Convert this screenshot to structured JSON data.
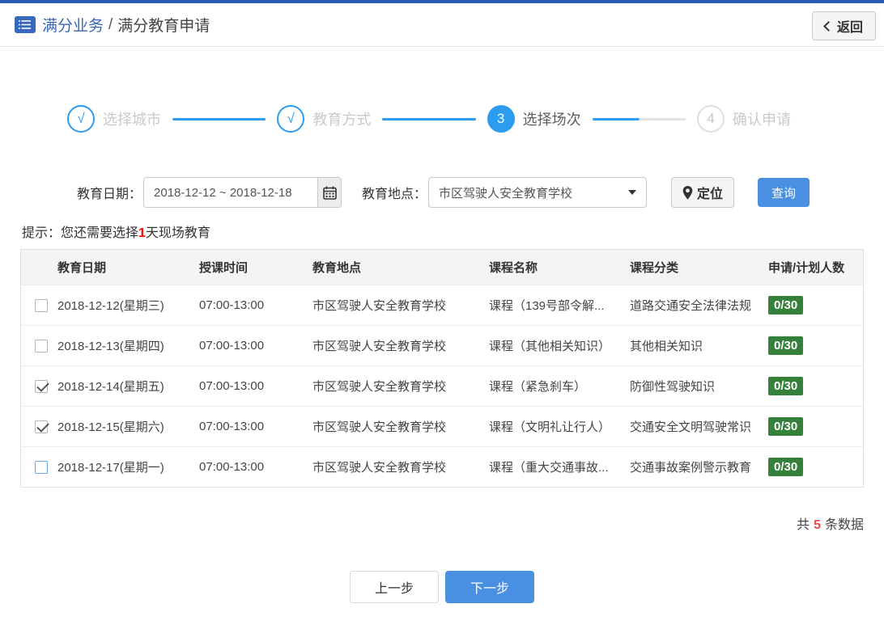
{
  "header": {
    "breadcrumb_primary": "满分业务",
    "breadcrumb_separator": "/",
    "breadcrumb_secondary": "满分教育申请",
    "back_button": "返回"
  },
  "steps": {
    "items": [
      {
        "num": "√",
        "label": "选择城市",
        "state": "done"
      },
      {
        "num": "√",
        "label": "教育方式",
        "state": "done"
      },
      {
        "num": "3",
        "label": "选择场次",
        "state": "active"
      },
      {
        "num": "4",
        "label": "确认申请",
        "state": "pending"
      }
    ]
  },
  "filters": {
    "date_label": "教育日期：",
    "date_value": "2018-12-12 ~ 2018-12-18",
    "location_label": "教育地点：",
    "location_value": "市区驾驶人安全教育学校",
    "locate_button": "定位",
    "search_button": "查询"
  },
  "hint": {
    "prefix": "提示：您还需要选择",
    "highlight": "1",
    "suffix": "天现场教育"
  },
  "table": {
    "columns": [
      "教育日期",
      "授课时间",
      "教育地点",
      "课程名称",
      "课程分类",
      "申请/计划人数"
    ],
    "rows": [
      {
        "checked": false,
        "date": "2018-12-12(星期三)",
        "time": "07:00-13:00",
        "place": "市区驾驶人安全教育学校",
        "course": "课程（139号部令解...",
        "category": "道路交通安全法律法规",
        "quota": "0/30"
      },
      {
        "checked": false,
        "date": "2018-12-13(星期四)",
        "time": "07:00-13:00",
        "place": "市区驾驶人安全教育学校",
        "course": "课程（其他相关知识）",
        "category": "其他相关知识",
        "quota": "0/30"
      },
      {
        "checked": true,
        "date": "2018-12-14(星期五)",
        "time": "07:00-13:00",
        "place": "市区驾驶人安全教育学校",
        "course": "课程（紧急刹车）",
        "category": "防御性驾驶知识",
        "quota": "0/30"
      },
      {
        "checked": true,
        "date": "2018-12-15(星期六)",
        "time": "07:00-13:00",
        "place": "市区驾驶人安全教育学校",
        "course": "课程（文明礼让行人）",
        "category": "交通安全文明驾驶常识",
        "quota": "0/30"
      },
      {
        "checked": false,
        "date": "2018-12-17(星期一)",
        "time": "07:00-13:00",
        "place": "市区驾驶人安全教育学校",
        "course": "课程（重大交通事故...",
        "category": "交通事故案例警示教育",
        "quota": "0/30"
      }
    ]
  },
  "summary": {
    "prefix": "共",
    "count": "5",
    "suffix": "条数据"
  },
  "footer": {
    "prev_button": "上一步",
    "next_button": "下一步"
  },
  "icons": {
    "header": "list-icon",
    "back": "chevron-left-icon",
    "date": "calendar-icon",
    "location_select": "caret-down-icon",
    "locate": "map-pin-icon"
  },
  "colors": {
    "top_bar": "#2b5cb5",
    "accent_blue": "#2d9cf0",
    "button_blue": "#4a90e2",
    "badge_green": "#35813b",
    "highlight_red": "#ff0000",
    "count_red": "#e64c4c"
  }
}
